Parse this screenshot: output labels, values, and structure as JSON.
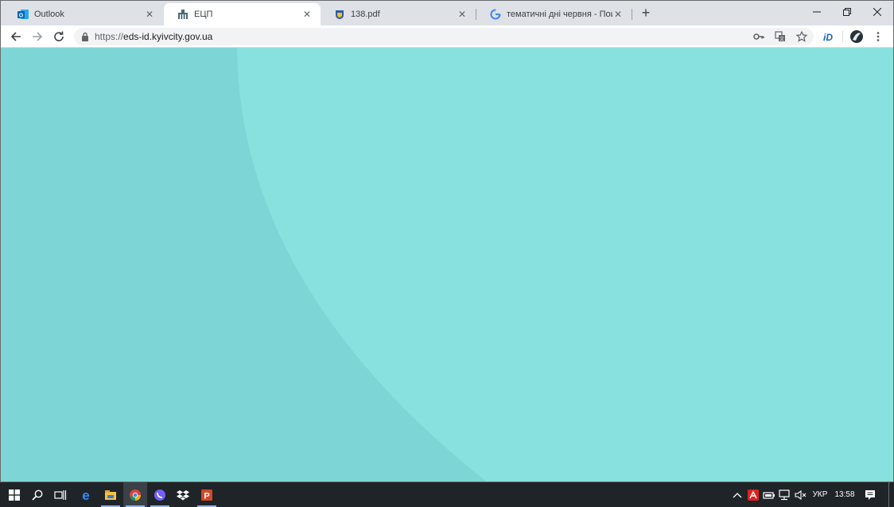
{
  "browser": {
    "tabs": [
      {
        "title": "Outlook",
        "icon": "outlook-icon",
        "active": false
      },
      {
        "title": "ЕЦП",
        "icon": "kyiv-building-icon",
        "active": true
      },
      {
        "title": "138.pdf",
        "icon": "shield-crest-icon",
        "active": false
      },
      {
        "title": "тематичні дні червня - Поиск в",
        "icon": "google-icon",
        "active": false
      }
    ],
    "new_tab_label": "+",
    "close_glyph": "✕",
    "url": {
      "scheme": "https://",
      "host": "eds-id.kyivcity.gov.ua"
    }
  },
  "page": {
    "background_color": "#7dd6d5",
    "arc_color": "#88e1de"
  },
  "taskbar": {
    "language": "УКР",
    "time": "13:58"
  }
}
